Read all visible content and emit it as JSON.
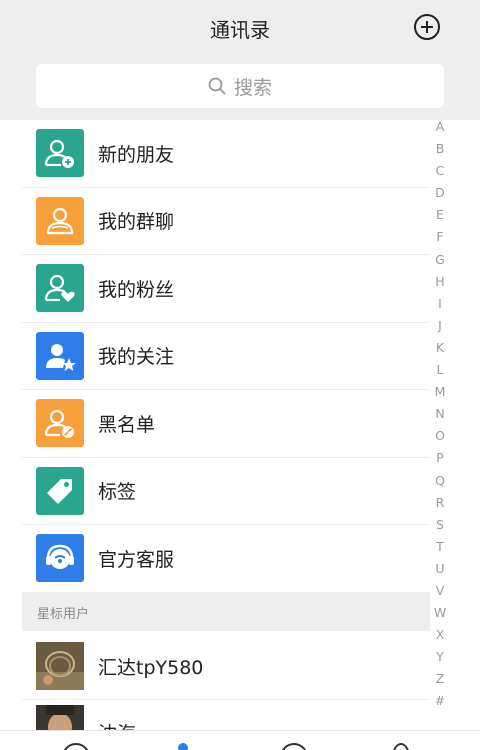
{
  "header": {
    "title": "通讯录"
  },
  "search": {
    "placeholder": "搜索"
  },
  "menu": [
    {
      "label": "新的朋友",
      "icon": "person-add-icon",
      "color": "#2aa58e"
    },
    {
      "label": "我的群聊",
      "icon": "group-icon",
      "color": "#f7a03b"
    },
    {
      "label": "我的粉丝",
      "icon": "person-heart-icon",
      "color": "#2aa58e"
    },
    {
      "label": "我的关注",
      "icon": "person-star-icon",
      "color": "#2f7de8"
    },
    {
      "label": "黑名单",
      "icon": "person-block-icon",
      "color": "#f7a03b"
    },
    {
      "label": "标签",
      "icon": "tag-icon",
      "color": "#2aa58e"
    },
    {
      "label": "官方客服",
      "icon": "headset-icon",
      "color": "#2f7de8"
    }
  ],
  "starred": {
    "title": "星标用户",
    "contacts": [
      {
        "name": "汇达tpY580"
      },
      {
        "name": "沈海"
      }
    ]
  },
  "index_letters": [
    "A",
    "B",
    "C",
    "D",
    "E",
    "F",
    "G",
    "H",
    "I",
    "J",
    "K",
    "L",
    "M",
    "N",
    "O",
    "P",
    "Q",
    "R",
    "S",
    "T",
    "U",
    "V",
    "W",
    "X",
    "Y",
    "Z",
    "#"
  ],
  "colors": {
    "accent": "#2f7de8",
    "teal": "#2aa58e",
    "orange": "#f7a03b"
  }
}
